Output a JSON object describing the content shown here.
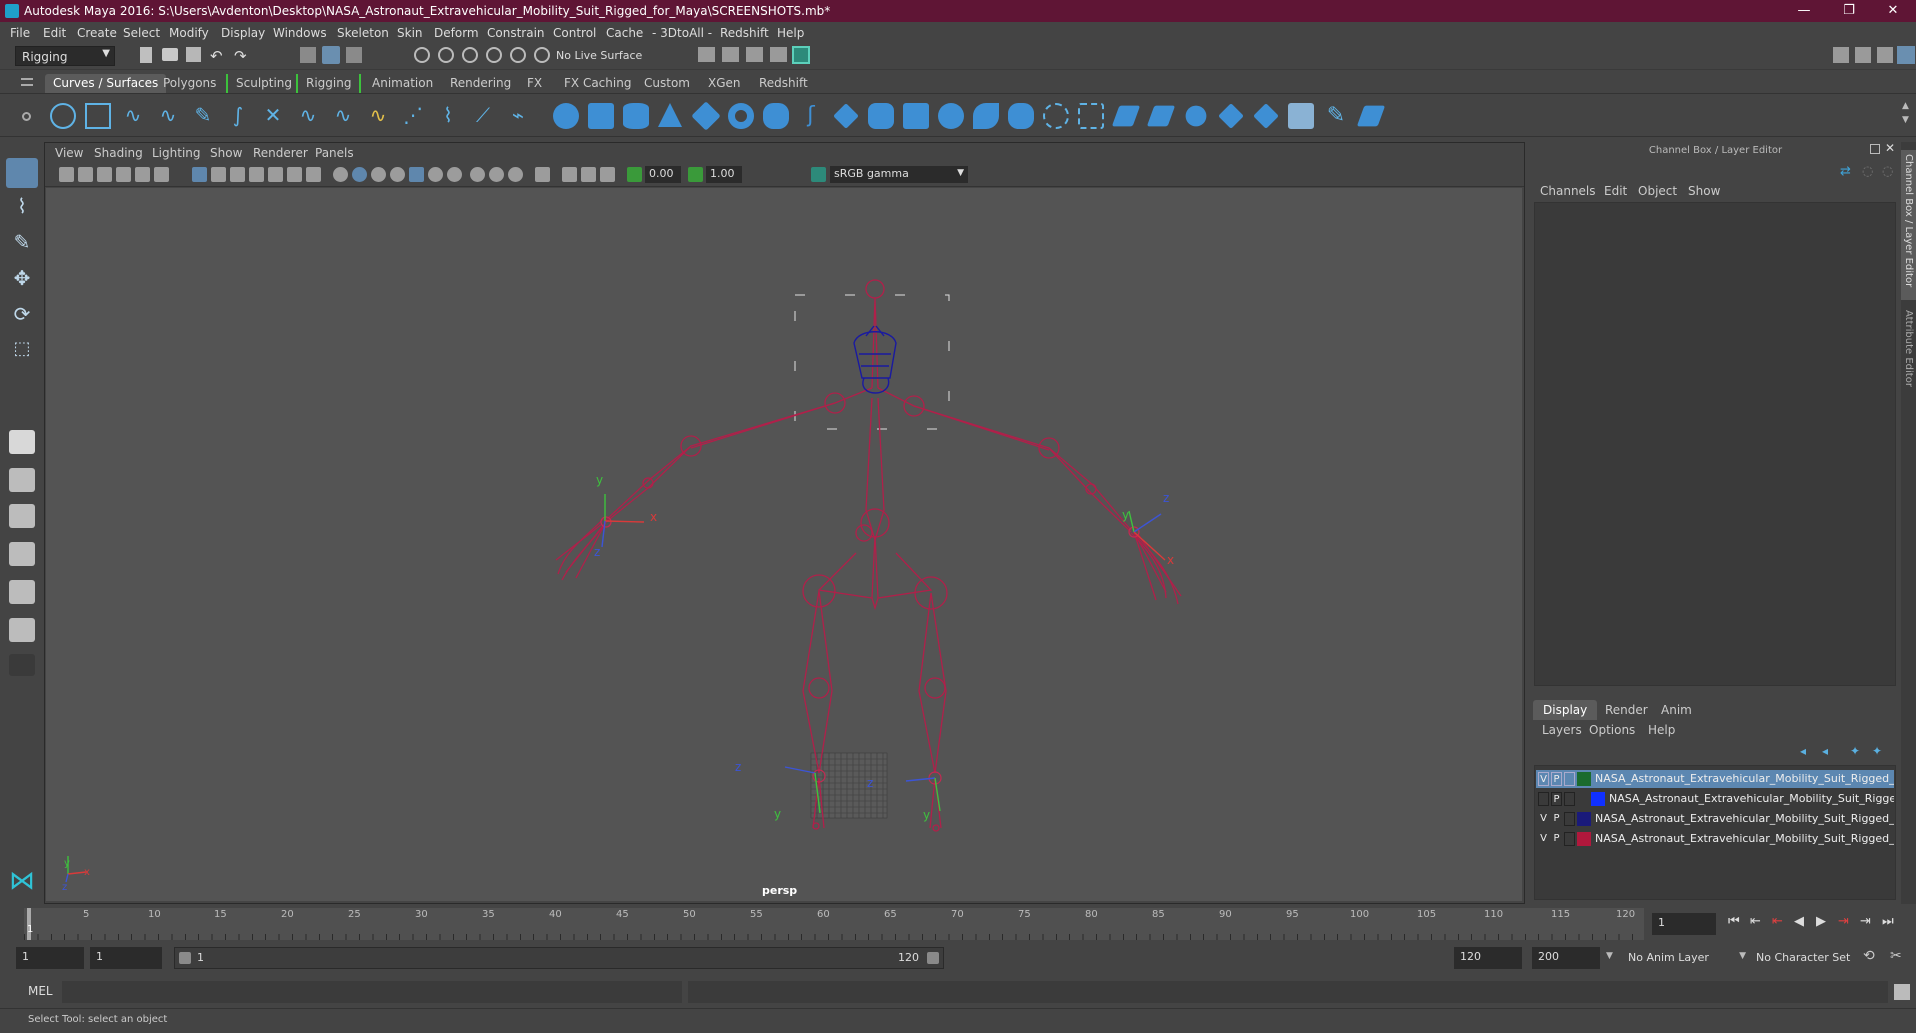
{
  "window": {
    "title": "Autodesk Maya 2016: S:\\Users\\Avdenton\\Desktop\\NASA_Astronaut_Extravehicular_Mobility_Suit_Rigged_for_Maya\\SCREENSHOTS.mb*",
    "controls": [
      "—",
      "❐",
      "✕"
    ]
  },
  "menubar": [
    "File",
    "Edit",
    "Create",
    "Select",
    "Modify",
    "Display",
    "Windows",
    "Skeleton",
    "Skin",
    "Deform",
    "Constrain",
    "Control",
    "Cache",
    "- 3DtoAll -",
    "Redshift",
    "Help"
  ],
  "statusline": {
    "mode": "Rigging",
    "live_surface": "No Live Surface"
  },
  "shelf_tabs": [
    "Curves / Surfaces",
    "Polygons",
    "Sculpting",
    "Rigging",
    "Animation",
    "Rendering",
    "FX",
    "FX Caching",
    "Custom",
    "XGen",
    "Redshift"
  ],
  "shelf_active": "Curves / Surfaces",
  "panel_menu": [
    "View",
    "Shading",
    "Lighting",
    "Show",
    "Renderer",
    "Panels"
  ],
  "panel_tools": {
    "exposure": "0.00",
    "gamma": "1.00",
    "color_space": "sRGB gamma"
  },
  "viewport": {
    "camera_label": "persp",
    "axis_labels": {
      "x": "x",
      "y": "y",
      "z": "z"
    },
    "rig_color": "#b0204a",
    "joint_color": "#c42a52"
  },
  "channel_box": {
    "header": "Channel Box / Layer Editor",
    "menu": [
      "Channels",
      "Edit",
      "Object",
      "Show"
    ],
    "side_tabs": [
      "Channel Box / Layer Editor",
      "Attribute Editor"
    ]
  },
  "layer_editor": {
    "tabs": [
      "Display",
      "Render",
      "Anim"
    ],
    "active_tab": "Display",
    "menu": [
      "Layers",
      "Options",
      "Help"
    ],
    "layers": [
      {
        "v": "V",
        "p": "P",
        "color": "#1b6b2e",
        "name": "NASA_Astronaut_Extravehicular_Mobility_Suit_Rigged_C(",
        "selected": true
      },
      {
        "v": "",
        "p": "P",
        "color": "#1030ff",
        "name": "NASA_Astronaut_Extravehicular_Mobility_Suit_Rigged",
        "selected": false
      },
      {
        "v": "V",
        "p": "P",
        "color": "#1a1a7a",
        "name": "NASA_Astronaut_Extravehicular_Mobility_Suit_Rigged_HI",
        "selected": false
      },
      {
        "v": "V",
        "p": "P",
        "color": "#b0183c",
        "name": "NASA_Astronaut_Extravehicular_Mobility_Suit_Rigged_B(",
        "selected": false
      }
    ]
  },
  "timeline": {
    "ticks": [
      "5",
      "10",
      "15",
      "20",
      "25",
      "30",
      "35",
      "40",
      "45",
      "50",
      "55",
      "60",
      "65",
      "70",
      "75",
      "80",
      "85",
      "90",
      "95",
      "100",
      "105",
      "110",
      "115",
      "120"
    ],
    "current_frame": "1",
    "first_tick": "1"
  },
  "range": {
    "start": "1",
    "playback_start": "1",
    "slider_start": "1",
    "slider_end": "120",
    "playback_end": "120",
    "end": "200",
    "anim_layer": "No Anim Layer",
    "character_set": "No Character Set"
  },
  "command": {
    "lang": "MEL"
  },
  "help_line": "Select Tool: select an object"
}
